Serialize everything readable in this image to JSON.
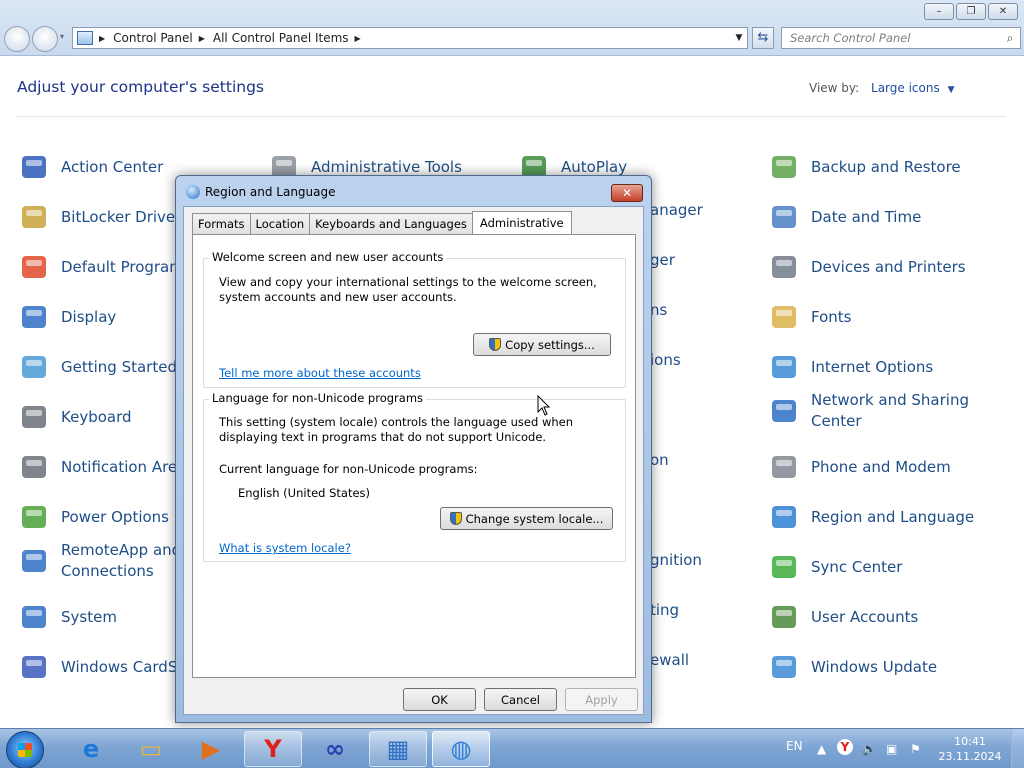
{
  "window": {
    "controls": {
      "minimize": "–",
      "restore": "❐",
      "close": "✕"
    },
    "breadcrumb": [
      "Control Panel",
      "All Control Panel Items"
    ],
    "search_placeholder": "Search Control Panel",
    "heading": "Adjust your computer's settings",
    "view_by_label": "View by:",
    "view_by_value": "Large icons"
  },
  "items": [
    {
      "label": "Action Center",
      "icon": "flag-icon",
      "color": "#2a5bb8"
    },
    {
      "label": "Administrative Tools",
      "icon": "gears-icon",
      "color": "#8a8f99"
    },
    {
      "label": "AutoPlay",
      "icon": "autoplay-icon",
      "color": "#3b8b3b"
    },
    {
      "label": "Backup and Restore",
      "icon": "backup-icon",
      "color": "#5aa14a"
    },
    {
      "label": "BitLocker Drive E",
      "icon": "key-icon",
      "color": "#c8a23a"
    },
    {
      "label": "anager",
      "icon": "",
      "color": ""
    },
    {
      "label": "Date and Time",
      "icon": "calendar-icon",
      "color": "#4a7fc4"
    },
    {
      "label": "Default Program",
      "icon": "default-programs-icon",
      "color": "#e04a2a"
    },
    {
      "label": "ger",
      "icon": "",
      "color": ""
    },
    {
      "label": "Devices and Printers",
      "icon": "printer-icon",
      "color": "#707a88"
    },
    {
      "label": "Display",
      "icon": "monitor-icon",
      "color": "#2f6fc4"
    },
    {
      "label": "ns",
      "icon": "",
      "color": ""
    },
    {
      "label": "Fonts",
      "icon": "fonts-folder-icon",
      "color": "#d8b24a"
    },
    {
      "label": "Getting Started",
      "icon": "getting-started-icon",
      "color": "#4a9ad4"
    },
    {
      "label": "ions",
      "icon": "",
      "color": ""
    },
    {
      "label": "Internet Options",
      "icon": "internet-options-icon",
      "color": "#3b8bd4"
    },
    {
      "label": "Keyboard",
      "icon": "keyboard-icon",
      "color": "#6a6f78"
    },
    {
      "label": "Network and Sharing Center",
      "icon": "network-icon",
      "color": "#2f6fc4"
    },
    {
      "label": "Notification Area",
      "icon": "notification-area-icon",
      "color": "#6a6f78"
    },
    {
      "label": "on",
      "icon": "",
      "color": ""
    },
    {
      "label": "Phone and Modem",
      "icon": "phone-icon",
      "color": "#808690"
    },
    {
      "label": "Power Options",
      "icon": "power-icon",
      "color": "#4aa13a"
    },
    {
      "label": "Region and Language",
      "icon": "globe-clock-icon",
      "color": "#2f7fd4"
    },
    {
      "label": "RemoteApp and Connections",
      "icon": "remoteapp-icon",
      "color": "#2f6fc4"
    },
    {
      "label": "gnition",
      "icon": "",
      "color": ""
    },
    {
      "label": "Sync Center",
      "icon": "sync-icon",
      "color": "#3bab3b"
    },
    {
      "label": "System",
      "icon": "system-icon",
      "color": "#2f6fc4"
    },
    {
      "label": "ting",
      "icon": "",
      "color": ""
    },
    {
      "label": "User Accounts",
      "icon": "user-accounts-icon",
      "color": "#4a8a3a"
    },
    {
      "label": "Windows CardSp",
      "icon": "cardspace-icon",
      "color": "#3b5bb8"
    },
    {
      "label": "ewall",
      "icon": "",
      "color": ""
    },
    {
      "label": "Windows Update",
      "icon": "windows-update-icon",
      "color": "#3b8bd4"
    }
  ],
  "dialog": {
    "title": "Region and Language",
    "tabs": [
      "Formats",
      "Location",
      "Keyboards and Languages",
      "Administrative"
    ],
    "active_tab": "Administrative",
    "welcome": {
      "title": "Welcome screen and new user accounts",
      "text": "View and copy your international settings to the welcome screen, system accounts and new user accounts.",
      "button": "Copy settings...",
      "link": "Tell me more about these accounts"
    },
    "nonunicode": {
      "title": "Language for non-Unicode programs",
      "text": "This setting (system locale) controls the language used when displaying text in programs that do not support Unicode.",
      "current_label": "Current language for non-Unicode programs:",
      "current_value": "English (United States)",
      "button": "Change system locale...",
      "link": "What is system locale?"
    },
    "buttons": {
      "ok": "OK",
      "cancel": "Cancel",
      "apply": "Apply"
    }
  },
  "taskbar": {
    "apps": [
      {
        "name": "internet-explorer-icon",
        "state": "pinned"
      },
      {
        "name": "file-explorer-icon",
        "state": "pinned"
      },
      {
        "name": "media-player-icon",
        "state": "pinned"
      },
      {
        "name": "yandex-browser-icon",
        "state": "open"
      },
      {
        "name": "infinity-app-icon",
        "state": "pinned"
      },
      {
        "name": "control-panel-icon",
        "state": "open"
      },
      {
        "name": "region-language-icon",
        "state": "active"
      }
    ],
    "language": "EN",
    "time": "10:41",
    "date": "23.11.2024"
  }
}
